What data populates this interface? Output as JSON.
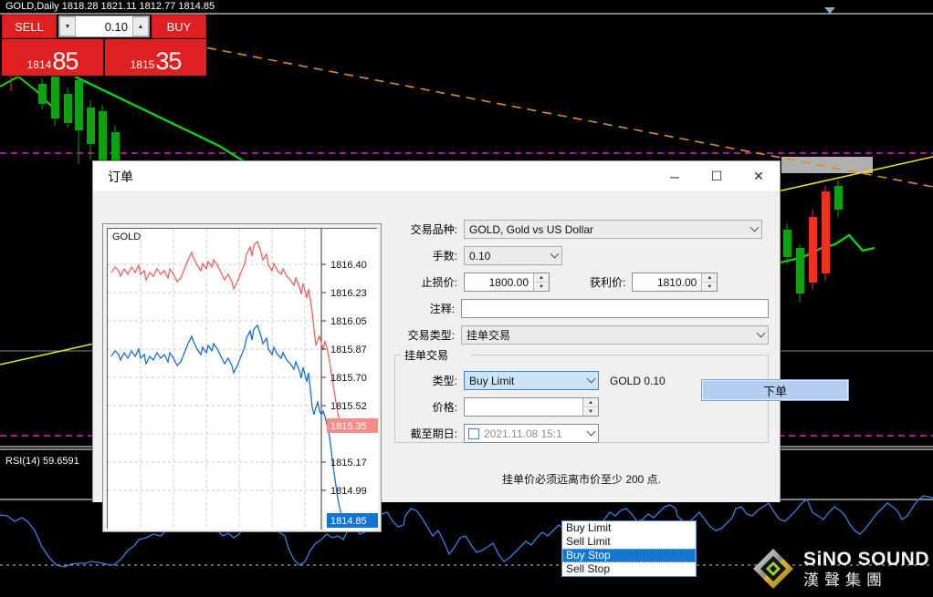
{
  "terminal": {
    "symbol_header": "GOLD,Daily  1818.28 1821.11 1812.77 1814.85",
    "rsi_label": "RSI(14) 59.6591",
    "one_click": {
      "sell_label": "SELL",
      "buy_label": "BUY",
      "volume": "0.10",
      "sell_price_int": "1814",
      "sell_price_dec": "85",
      "buy_price_int": "1815",
      "buy_price_dec": "35",
      "down_arrow": "▼",
      "up_arrow": "▲"
    },
    "watermark": {
      "english": "SiNO SOUND",
      "chinese": "漢聲集團"
    }
  },
  "dialog": {
    "title": "订单",
    "minimize": "─",
    "maximize": "☐",
    "close": "✕",
    "tick_chart": {
      "symbol": "GOLD",
      "ask_label": "1815.35",
      "bid_label": "1814.85",
      "axis_labels": [
        "1816.40",
        "1816.23",
        "1816.05",
        "1815.87",
        "1815.70",
        "1815.52",
        "1815.35",
        "1815.17",
        "1814.99",
        "1814.85"
      ],
      "ask_color": "#f2635f",
      "bid_color": "#1a6fd4"
    },
    "fields": {
      "symbol_label": "交易品种:",
      "symbol_value": "GOLD, Gold vs US Dollar",
      "lots_label": "手数:",
      "lots_value": "0.10",
      "sl_label": "止损价:",
      "sl_value": "1800.00",
      "tp_label": "获利价:",
      "tp_value": "1810.00",
      "comment_label": "注释:",
      "comment_value": "",
      "trade_type_label": "交易类型:",
      "trade_type_value": "挂单交易"
    },
    "pending": {
      "legend": "挂单交易",
      "type_label": "类型:",
      "type_value": "Buy Limit",
      "lot_note": "GOLD 0.10",
      "price_label": "价格:",
      "price_value": "",
      "expiry_label": "截至期日:",
      "expiry_value": "2021.11.08 15:1",
      "options": [
        {
          "label": "Buy Limit",
          "selected": false
        },
        {
          "label": "Sell Limit",
          "selected": false
        },
        {
          "label": "Buy Stop",
          "selected": true
        },
        {
          "label": "Sell Stop",
          "selected": false
        }
      ]
    },
    "submit_label": "下单",
    "warning": "挂单价必须远离市价至少 200 点."
  },
  "colors": {
    "sell_buy_red": "#e02020",
    "accent_blue": "#1675d1",
    "magenta_line": "#e020c0",
    "orange_trend": "#e08a2a",
    "yellow_trend": "#e8e82a",
    "green_ma": "#10d010"
  }
}
